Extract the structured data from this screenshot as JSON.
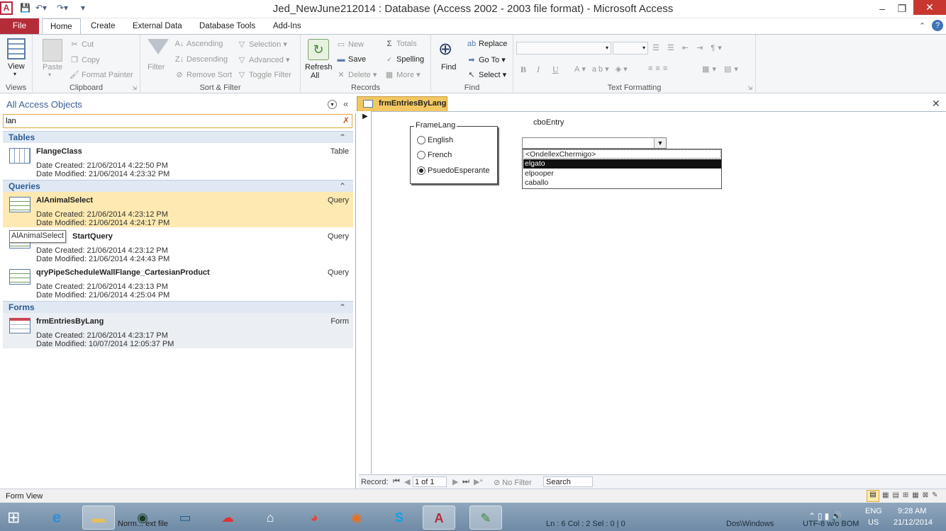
{
  "window": {
    "title": "Jed_NewJune212014 : Database (Access 2002 - 2003 file format) - Microsoft Access",
    "app_icon": "A",
    "controls": {
      "minimize": "–",
      "restore": "❐",
      "close": "✕"
    }
  },
  "tabs": [
    "File",
    "Home",
    "Create",
    "External Data",
    "Database Tools",
    "Add-Ins"
  ],
  "ribbon": {
    "views": {
      "view_label": "View",
      "group": "Views"
    },
    "clipboard": {
      "paste": "Paste",
      "cut": "Cut",
      "copy": "Copy",
      "format_painter": "Format Painter",
      "group": "Clipboard"
    },
    "sort_filter": {
      "filter": "Filter",
      "ascending": "Ascending",
      "descending": "Descending",
      "remove_sort": "Remove Sort",
      "selection": "Selection",
      "advanced": "Advanced",
      "toggle_filter": "Toggle Filter",
      "group": "Sort & Filter"
    },
    "records": {
      "refresh": "Refresh",
      "refresh_all": "All",
      "new": "New",
      "save": "Save",
      "delete": "Delete",
      "totals": "Totals",
      "spelling": "Spelling",
      "more": "More",
      "group": "Records"
    },
    "find": {
      "find": "Find",
      "replace": "Replace",
      "goto": "Go To",
      "select": "Select",
      "group": "Find"
    },
    "text_formatting": {
      "group": "Text Formatting",
      "bold": "B",
      "italic": "I",
      "underline": "U"
    }
  },
  "nav": {
    "title": "All Access Objects",
    "search_value": "lan",
    "sections": {
      "tables": {
        "label": "Tables",
        "items": [
          {
            "name": "FlangeClass",
            "type": "Table",
            "created": "Date Created: 21/06/2014 4:22:50 PM",
            "modified": "Date Modified: 21/06/2014 4:23:32 PM"
          }
        ]
      },
      "queries": {
        "label": "Queries",
        "items": [
          {
            "name": "AlAnimalSelect",
            "type": "Query",
            "created": "Date Created: 21/06/2014 4:23:12 PM",
            "modified": "Date Modified: 21/06/2014 4:24:17 PM"
          },
          {
            "name": "StartQuery",
            "type": "Query",
            "created": "Date Created: 21/06/2014 4:23:12 PM",
            "modified": "Date Modified: 21/06/2014 4:24:43 PM"
          },
          {
            "name": "qryPipeScheduleWallFlange_CartesianProduct",
            "type": "Query",
            "created": "Date Created: 21/06/2014 4:23:13 PM",
            "modified": "Date Modified: 21/06/2014 4:25:04 PM"
          }
        ]
      },
      "forms": {
        "label": "Forms",
        "items": [
          {
            "name": "frmEntriesByLang",
            "type": "Form",
            "created": "Date Created: 21/06/2014 4:23:17 PM",
            "modified": "Date Modified: 10/07/2014 12:05:37 PM"
          }
        ]
      }
    },
    "tooltip": "AlAnimalSelect"
  },
  "doc": {
    "tab_label": "frmEntriesByLang",
    "frame_label": "FrameLang",
    "radios": [
      {
        "label": "English",
        "checked": false
      },
      {
        "label": "French",
        "checked": false
      },
      {
        "label": "PsuedoEsperante",
        "checked": true
      }
    ],
    "combo_label": "cboEntry",
    "combo_options": [
      "<OndellexChermigo>",
      "elgato",
      "elpooper",
      "caballo"
    ],
    "combo_selected": "elgato"
  },
  "record_nav": {
    "label": "Record:",
    "position": "1 of 1",
    "filter": "No Filter",
    "search": "Search"
  },
  "status": {
    "view": "Form View"
  },
  "taskbar": {
    "label1": "Norm... ext file",
    "label2": "Ln : 6   Col : 2   Sel : 0 | 0",
    "label3": "Dos\\Windows",
    "label4": "UTF-8 w/o BOM",
    "lang": "ENG",
    "region": "US",
    "time": "9:28 AM",
    "date": "21/12/2014"
  },
  "colors": {
    "file_tab": "#b52c39",
    "selected_item": "#fde9b1",
    "doc_tab": "#f3c862",
    "close": "#c7372f"
  }
}
